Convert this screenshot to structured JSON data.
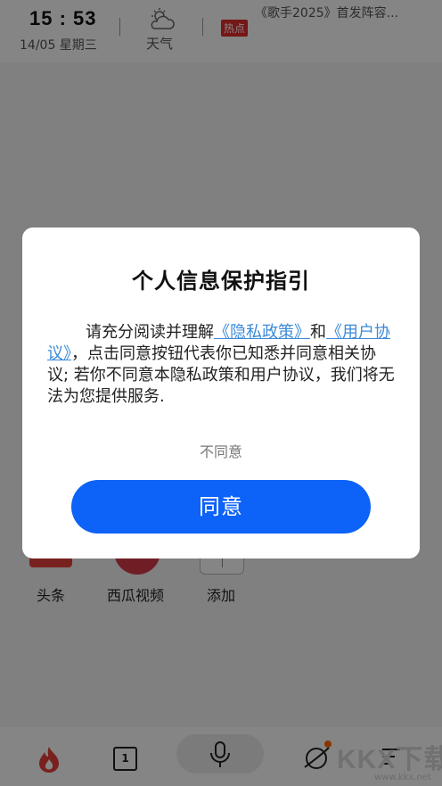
{
  "status": {
    "time": "15 : 53",
    "date": "14/05  星期三",
    "weather_label": "天气",
    "hot_badge": "热点",
    "hot_text": "《歌手2025》首发阵容..."
  },
  "shortcuts": [
    {
      "label": "头条"
    },
    {
      "label": "西瓜视频"
    },
    {
      "label": "添加"
    }
  ],
  "bottom_bar": {
    "tabs_count": "1"
  },
  "watermark": {
    "text": "KKX下载",
    "small": "www.kkx.net"
  },
  "dialog": {
    "title": "个人信息保护指引",
    "body_intro": "请充分阅读并理解",
    "privacy_link": "《隐私政策》",
    "and": "和",
    "agreement_link": "《用户协议》",
    "body_rest": "，点击同意按钮代表你已知悉并同意相关协议; 若你不同意本隐私政策和用户协议，我们将无法为您提供服务.",
    "disagree_label": "不同意",
    "agree_label": "同意"
  },
  "colors": {
    "accent": "#0d62f7",
    "link": "#3b8ad8",
    "hot_badge": "#e22b2b",
    "fire": "#e8403a",
    "notification_dot": "#ff6a00"
  }
}
